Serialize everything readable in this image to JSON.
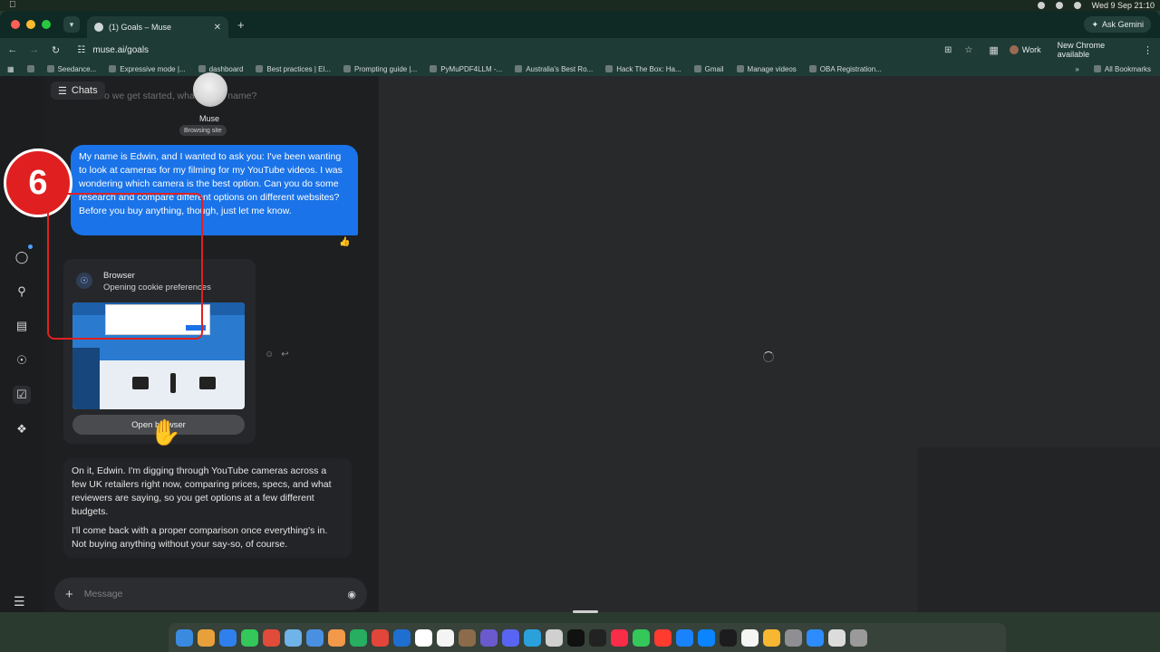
{
  "menubar": {
    "date_time": "Wed 9 Sep  21:10"
  },
  "browser": {
    "tab_title": "(1) Goals – Muse",
    "ask_gemini": "Ask Gemini",
    "url": "muse.ai/goals",
    "profile": "Work",
    "update_notice": "New Chrome available",
    "bookmarks": [
      "Seedance...",
      "Expressive mode |...",
      "dashboard",
      "Best practices | El...",
      "Prompting guide |...",
      "PyMuPDF4LLM -...",
      "Australia's Best Ro...",
      "Hack The Box: Ha...",
      "Gmail",
      "Manage videos",
      "OBA Registration..."
    ],
    "all_bookmarks": "All Bookmarks"
  },
  "chat": {
    "chats_label": "Chats",
    "previous_question": "So we get started, what's your name?",
    "assistant_name": "Muse",
    "assistant_status": "Browsing site",
    "user_message": "My name is Edwin, and I wanted to ask you: I've been wanting to look at cameras for my filming for my YouTube videos. I was wondering which camera is the best option. Can you do some research and compare different options on different websites? Before you buy anything, though, just let me know.",
    "browser_card": {
      "title": "Browser",
      "status": "Opening cookie preferences",
      "button": "Open browser"
    },
    "assistant_reply": [
      "On it, Edwin. I'm digging through YouTube cameras across a few UK retailers right now, comparing prices, specs, and what reviewers are saying, so you get options at a few different budgets.",
      "I'll come back with a proper comparison once everything's in. Not buying anything without your say-so, of course."
    ],
    "composer_placeholder": "Message"
  },
  "annotation": {
    "step_number": "6",
    "accent": "#e02020"
  },
  "colors": {
    "user_bubble": "#1a73e8",
    "tab_strip": "#0f2a25"
  }
}
